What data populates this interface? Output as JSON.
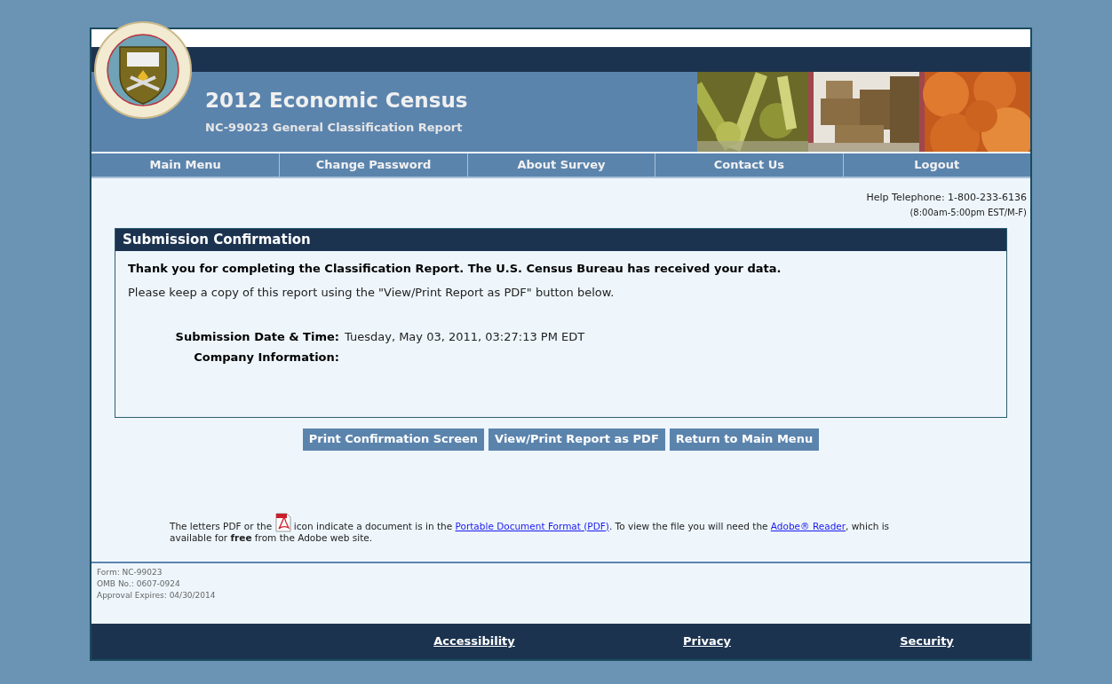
{
  "header": {
    "title": "2012 Economic Census",
    "subtitle": "NC-99023 General Classification Report"
  },
  "nav": [
    {
      "label": "Main Menu"
    },
    {
      "label": "Change Password"
    },
    {
      "label": "About Survey"
    },
    {
      "label": "Contact Us"
    },
    {
      "label": "Logout"
    }
  ],
  "help": {
    "phone": "Help Telephone: 1-800-233-6136",
    "hours": "(8:00am-5:00pm EST/M-F)"
  },
  "panel": {
    "title": "Submission Confirmation",
    "thanks": "Thank you for completing the Classification Report. The U.S. Census Bureau has received your data.",
    "instruction": "Please keep a copy of this report using the \"View/Print Report as PDF\" button below.",
    "fields": [
      {
        "label": "Submission Date & Time:",
        "value": "Tuesday, May 03, 2011, 03:27:13 PM EDT"
      },
      {
        "label": "Company Information:"
      }
    ]
  },
  "buttons": [
    "Print Confirmation Screen",
    "View/Print Report as PDF",
    "Return to Main Menu"
  ],
  "note": [
    {
      "kind": "text",
      "text": "The letters PDF or the"
    },
    {
      "kind": "icon"
    },
    {
      "kind": "text",
      "text": "icon indicate a document is in the"
    },
    {
      "kind": "link",
      "text": "Portable Document Format (PDF)"
    },
    {
      "kind": "text",
      "text": ". To view the file you will need the"
    },
    {
      "kind": "link",
      "text": "Adobe® Reader"
    },
    {
      "kind": "text",
      "text": ", which is available for **free** from the Adobe web site."
    }
  ],
  "form_info": [
    "Form: NC-99023",
    "OMB No.: 0607-0924",
    "Approval Expires: 04/30/2014"
  ],
  "footer_links": [
    "Accessibility",
    "Privacy",
    "Security"
  ]
}
